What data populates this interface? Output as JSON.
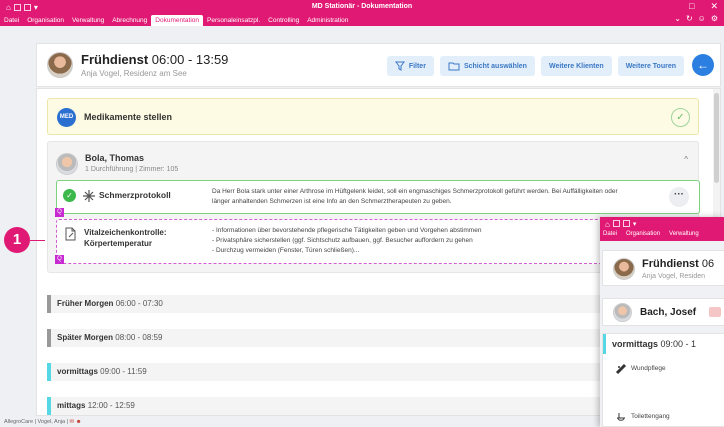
{
  "window": {
    "title": "MD Stationär - Dokumentation",
    "menu": [
      "Datei",
      "Organisation",
      "Verwaltung",
      "Abrechnung",
      "Dokumentation",
      "Personaleinsatzpl.",
      "Controlling",
      "Administration"
    ],
    "active_menu_index": 4,
    "controls": {
      "minimize": "□",
      "close": "✕"
    },
    "right_icons": [
      "⌄",
      "↻",
      "☺",
      "⚙"
    ]
  },
  "header": {
    "shift_name": "Frühdienst",
    "shift_time": "06:00 - 13:59",
    "subtitle": "Anja Vogel, Residenz am See",
    "buttons": {
      "filter": "Filter",
      "select_shift": "Schicht auswählen",
      "more_clients": "Weitere Klienten",
      "more_tours": "Weitere Touren"
    },
    "back": "←"
  },
  "medication": {
    "badge": "MED",
    "label": "Medikamente stellen",
    "check": "✓"
  },
  "client": {
    "name": "Bola, Thomas",
    "info": "1 Durchführung | Zimmer: 105",
    "caret": "^",
    "tasks": [
      {
        "name": "Schmerzprotokoll",
        "description": "Da Herr Bola stark unter einer Arthrose im Hüftgelenk leidet, soll ein engmaschiges Schmerzprotokoll geführt werden. Bei Auffälligkeiten oder länger anhaltenden Schmerzen ist eine Info an den Schmerztherapeuten zu geben.",
        "more": "···",
        "status": "✓",
        "q_badge": "Q"
      },
      {
        "name": "Vitalzeichenkontrolle: Körpertemperatur",
        "description_lines": [
          "- Informationen über bevorstehende pflegerische Tätigkeiten geben und Vorgehen abstimmen",
          "- Privatsphäre sicherstellen (ggf. Sichtschutz aufbauen, ggf. Besucher auffordern zu gehen",
          "- Durchzug vermeiden (Fenster, Türen schließen)..."
        ],
        "q_badge": "Q"
      }
    ]
  },
  "shifts": [
    {
      "name": "Früher Morgen",
      "time": "06:00 - 07:30",
      "color": "#999999"
    },
    {
      "name": "Später Morgen",
      "time": "08:00 - 08:59",
      "color": "#999999"
    },
    {
      "name": "vormittags",
      "time": "09:00 - 11:59",
      "color": "#56d8e4"
    },
    {
      "name": "mittags",
      "time": "12:00 - 12:59",
      "color": "#56d8e4"
    }
  ],
  "callout": {
    "number": "1"
  },
  "statusbar": {
    "text": "AllegroCare | Vogel, Anja |"
  },
  "overlay": {
    "menu": [
      "Datei",
      "Organisation",
      "Verwaltung"
    ],
    "shift_name": "Frühdienst",
    "shift_time": "06",
    "subtitle": "Anja Vogel, Residen",
    "client_name": "Bach, Josef",
    "section_name": "vormittags",
    "section_time": "09:00 - 1",
    "items": [
      "Wundpflege",
      "Toilettengang"
    ]
  },
  "colors": {
    "brand": "#e01a74",
    "accent": "#2b7fe0",
    "success": "#3cb94a",
    "q_badge": "#c62ad0"
  }
}
